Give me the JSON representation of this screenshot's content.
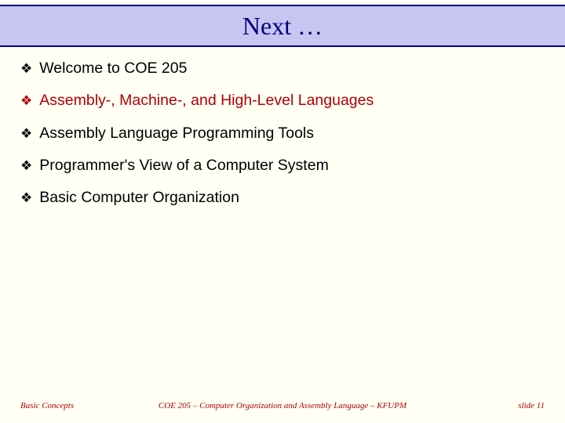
{
  "title": "Next …",
  "bullets": [
    {
      "text": "Welcome to COE 205",
      "active": false
    },
    {
      "text": "Assembly-, Machine-, and High-Level Languages",
      "active": true
    },
    {
      "text": "Assembly Language Programming Tools",
      "active": false
    },
    {
      "text": "Programmer's View of a Computer System",
      "active": false
    },
    {
      "text": "Basic Computer Organization",
      "active": false
    }
  ],
  "footer": {
    "left": "Basic Concepts",
    "center": "COE 205 – Computer Organization and Assembly Language – KFUPM",
    "right": "slide 11"
  },
  "glyphs": {
    "diamond": "❖"
  }
}
